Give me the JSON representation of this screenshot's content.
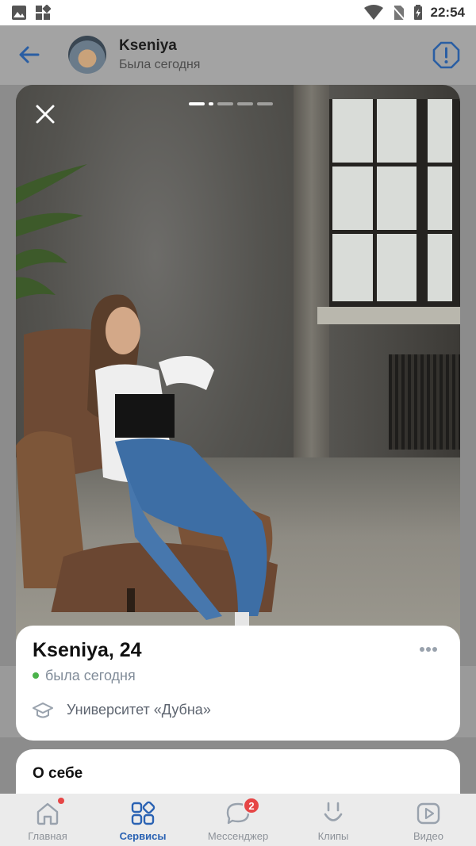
{
  "status_bar": {
    "time": "22:54"
  },
  "chat_header": {
    "name": "Kseniya",
    "status": "Была сегодня"
  },
  "photo": {
    "total": 5,
    "current": 2
  },
  "profile": {
    "name_age": "Kseniya, 24",
    "online_status": "была сегодня",
    "university": "Университет «Дубна»",
    "online_color": "#4bb34b"
  },
  "about": {
    "title": "О себе"
  },
  "tabs": [
    {
      "label": "Главная",
      "icon": "home-icon",
      "has_dot": true
    },
    {
      "label": "Сервисы",
      "icon": "services-icon",
      "active": true
    },
    {
      "label": "Мессенджер",
      "icon": "messenger-icon",
      "badge": "2"
    },
    {
      "label": "Клипы",
      "icon": "clips-icon"
    },
    {
      "label": "Видео",
      "icon": "video-icon"
    }
  ],
  "colors": {
    "accent": "#2a62b3",
    "badge": "#e64646"
  }
}
